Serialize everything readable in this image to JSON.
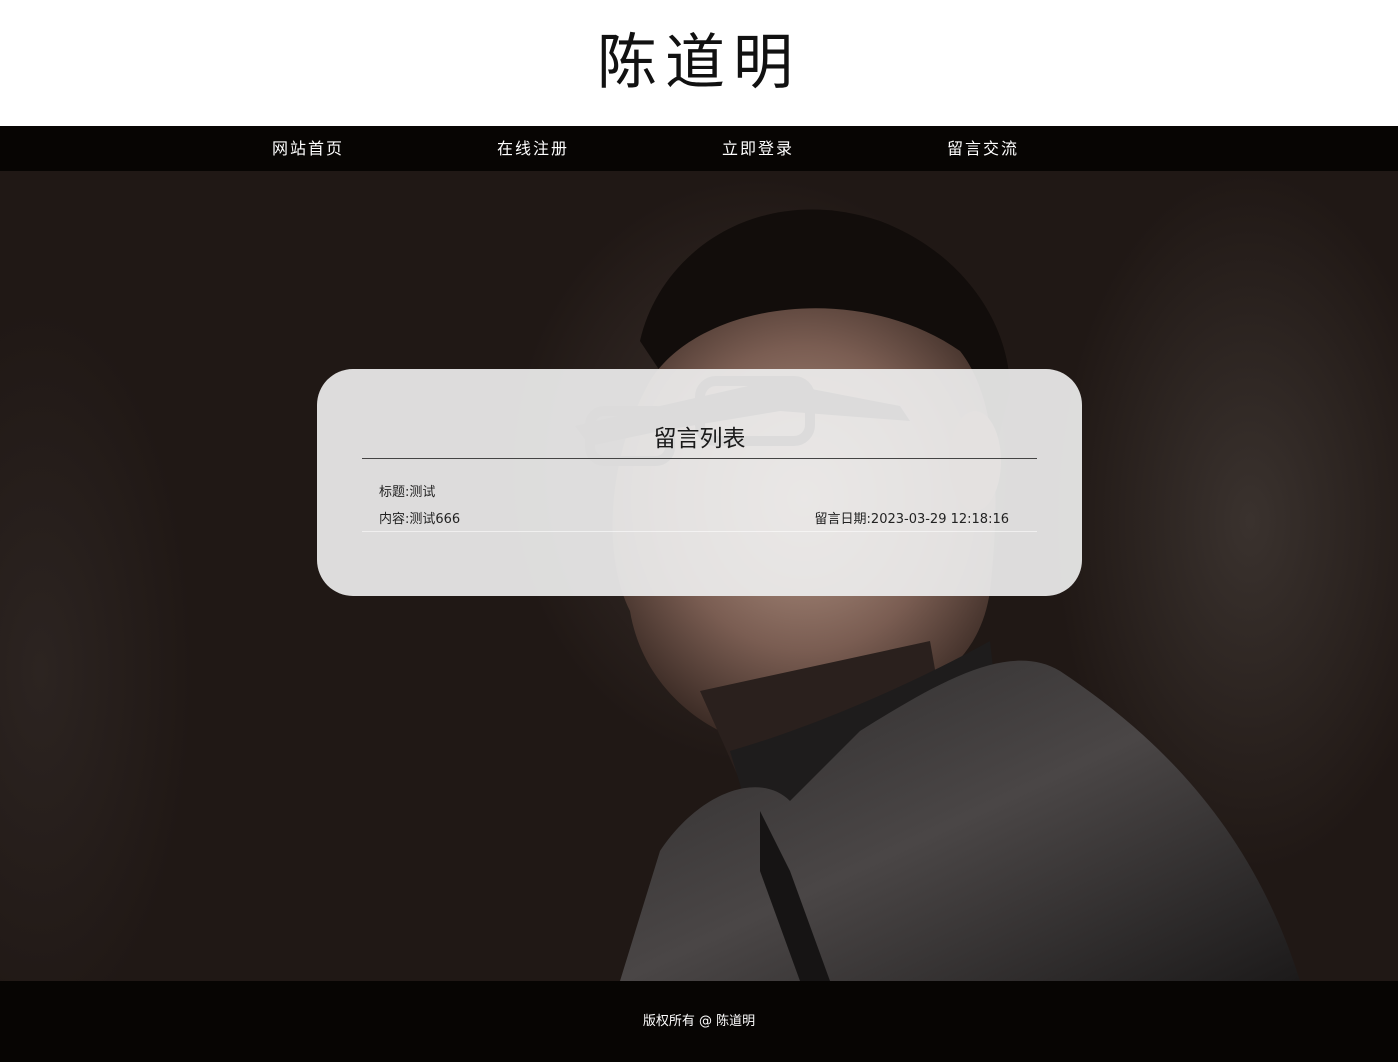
{
  "header": {
    "logo_text": "陈道明"
  },
  "nav": {
    "items": [
      {
        "label": "网站首页"
      },
      {
        "label": "在线注册"
      },
      {
        "label": "立即登录"
      },
      {
        "label": "留言交流"
      }
    ]
  },
  "main": {
    "panel_title": "留言列表",
    "messages": [
      {
        "subject": "标题:测试",
        "content": "内容:测试666",
        "date": "留言日期:2023-03-29 12:18:16"
      }
    ]
  },
  "footer": {
    "copyright": "版权所有 @ 陈道明"
  },
  "colors": {
    "nav_background": "#070503",
    "panel_background": "#eeeeee",
    "hero_background": "#201815"
  }
}
